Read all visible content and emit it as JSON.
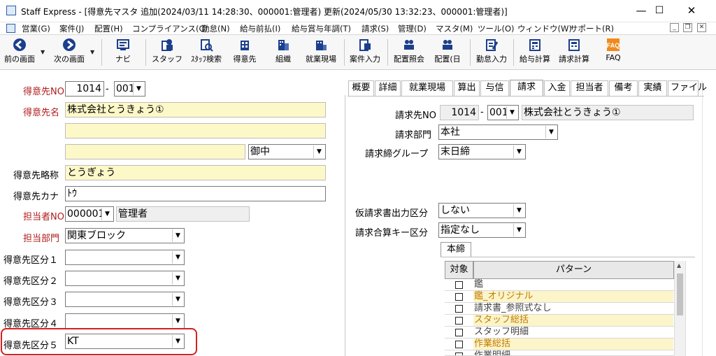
{
  "window": {
    "title": "Staff Express - [得意先マスタ  追加(2024/03/11 14:28:30、000001:管理者)  更新(2024/05/30 13:32:23、000001:管理者)]",
    "minimize_glyph": "—",
    "maximize_glyph": "☐",
    "close_glyph": "✕"
  },
  "menu": {
    "items": [
      "営業(G)",
      "案件(J)",
      "配置(H)",
      "コンプライアンス(C)",
      "勤怠(N)",
      "給与前払(I)",
      "給与賞与年調(T)",
      "請求(S)",
      "管理(D)",
      "マスタ(M)",
      "ツール(O)",
      "ウィンドウ(W)",
      "サポート(R)"
    ],
    "mdi_minimize": "_",
    "mdi_restore": "❐",
    "mdi_close": "✕"
  },
  "toolbar": {
    "items": [
      {
        "label": "前の画面",
        "icon": "back-arrow-icon"
      },
      {
        "label": "次の画面",
        "icon": "forward-arrow-icon"
      },
      {
        "label": "ナビ",
        "icon": "navi-icon"
      },
      {
        "label": "スタッフ",
        "icon": "staff-icon"
      },
      {
        "label": "ｽﾀｯﾌ検索",
        "icon": "staff-search-icon"
      },
      {
        "label": "得意先",
        "icon": "customer-icon"
      },
      {
        "label": "組織",
        "icon": "organization-icon"
      },
      {
        "label": "就業現場",
        "icon": "worksite-icon"
      },
      {
        "label": "案件入力",
        "icon": "project-input-icon"
      },
      {
        "label": "配置照会",
        "icon": "placement-inquiry-icon"
      },
      {
        "label": "配置(日",
        "icon": "placement-daily-icon"
      },
      {
        "label": "勤怠入力",
        "icon": "attendance-input-icon"
      },
      {
        "label": "給与計算",
        "icon": "payroll-icon"
      },
      {
        "label": "請求計算",
        "icon": "billing-icon"
      },
      {
        "label": "FAQ",
        "icon": "faq-icon"
      }
    ],
    "dropdown_glyph": "▼"
  },
  "left": {
    "customer_no_label": "得意先NO",
    "customer_no": "1014",
    "customer_no_sep": "-",
    "customer_branch": "001",
    "customer_name_label": "得意先名",
    "customer_name": "株式会社とうきょう①",
    "customer_name2": "",
    "customer_name3": "",
    "honorific": "御中",
    "short_name_label": "得意先略称",
    "short_name": "とうぎょう",
    "kana_label": "得意先カナ",
    "kana": "ﾄｳ",
    "person_label": "担当者NO",
    "person_no": "000001",
    "person_name": "管理者",
    "dept_label": "担当部門",
    "dept": "関東ブロック",
    "category1_label": "得意先区分１",
    "category1": "",
    "category2_label": "得意先区分２",
    "category2": "",
    "category3_label": "得意先区分３",
    "category3": "",
    "category4_label": "得意先区分４",
    "category4": "",
    "category5_label": "得意先区分５",
    "category5": "KT"
  },
  "tabs": [
    "概要",
    "詳細",
    "就業現場",
    "算出",
    "与信",
    "請求",
    "入金",
    "担当者",
    "備考",
    "実績",
    "ファイル"
  ],
  "active_tab": "請求",
  "right": {
    "billing_no_label": "請求先NO",
    "billing_no": "1014",
    "billing_no_sep": "-",
    "billing_branch": "001",
    "billing_name": "株式会社とうきょう①",
    "billing_dept_label": "請求部門",
    "billing_dept": "本社",
    "closing_group_label": "請求締グループ",
    "closing_group": "末日締",
    "provisional_label": "仮請求書出力区分",
    "provisional": "しない",
    "merge_key_label": "請求合算キー区分",
    "merge_key": "指定なし",
    "subtab": "本締",
    "grid_header_target": "対象",
    "grid_header_pattern": "パターン",
    "grid_rows": [
      {
        "pattern": "鑑",
        "highlight": false
      },
      {
        "pattern": "鑑_オリジナル",
        "highlight": true
      },
      {
        "pattern": "請求書_参照式なし",
        "highlight": false
      },
      {
        "pattern": "スタッフ総括",
        "highlight": true
      },
      {
        "pattern": "スタッフ明細",
        "highlight": false
      },
      {
        "pattern": "作業総括",
        "highlight": true
      },
      {
        "pattern": "作業明細",
        "highlight": false
      }
    ],
    "scroll_up_glyph": "▲"
  },
  "colors": {
    "required_label": "#b01c1c",
    "highlight_frame": "#d62020",
    "field_yellow": "#fdf8c8"
  }
}
